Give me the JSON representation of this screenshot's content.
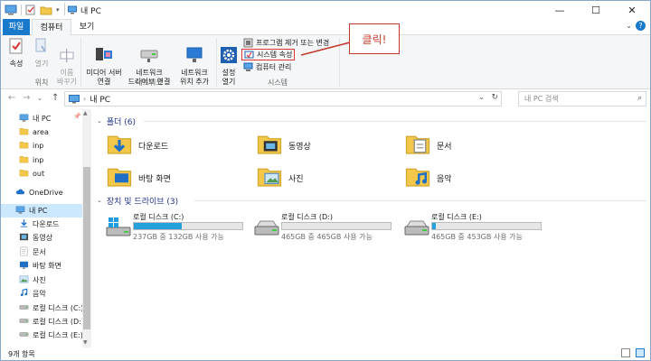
{
  "window": {
    "title": "내 PC",
    "minimize": "—",
    "maximize": "☐",
    "close": "✕"
  },
  "tabs": {
    "file": "파일",
    "computer": "컴퓨터",
    "view": "보기"
  },
  "ribbon": {
    "location": {
      "properties": "속성",
      "open": "열기",
      "rename": "이름\n바꾸기",
      "label": "위치"
    },
    "network": {
      "media_server": "미디어 서버\n연결",
      "map_drive": "네트워크\n드라이브 연결",
      "add_location": "네트워크\n위치 추가",
      "label": "네트워크"
    },
    "system": {
      "settings": "설정\n열기",
      "uninstall": "프로그램 제거 또는 변경",
      "system_props": "시스템 속성",
      "manage": "컴퓨터 관리",
      "label": "시스템"
    }
  },
  "callout": "클릭!",
  "address": {
    "path": "내 PC",
    "search_placeholder": "내 PC 검색"
  },
  "nav": {
    "items": [
      {
        "label": "내 PC",
        "icon": "pc-icon"
      },
      {
        "label": "area",
        "icon": "folder-icon"
      },
      {
        "label": "inp",
        "icon": "folder-icon"
      },
      {
        "label": "inp",
        "icon": "folder-icon"
      },
      {
        "label": "out",
        "icon": "folder-icon"
      },
      {
        "label": "OneDrive",
        "icon": "cloud-icon"
      },
      {
        "label": "내 PC",
        "icon": "pc-icon"
      },
      {
        "label": "다운로드",
        "icon": "download-icon"
      },
      {
        "label": "동영상",
        "icon": "video-icon"
      },
      {
        "label": "문서",
        "icon": "document-icon"
      },
      {
        "label": "바탕 화면",
        "icon": "desktop-icon"
      },
      {
        "label": "사진",
        "icon": "picture-icon"
      },
      {
        "label": "음악",
        "icon": "music-icon"
      },
      {
        "label": "로컬 디스크 (C:)",
        "icon": "drive-icon"
      },
      {
        "label": "로컬 디스크 (D:)",
        "icon": "drive-icon"
      },
      {
        "label": "로컬 디스크 (E:)",
        "icon": "drive-icon"
      }
    ]
  },
  "content": {
    "folders_header": "폴더 (6)",
    "folders": [
      {
        "label": "다운로드",
        "icon": "download-folder-icon"
      },
      {
        "label": "동영상",
        "icon": "video-folder-icon"
      },
      {
        "label": "문서",
        "icon": "document-folder-icon"
      },
      {
        "label": "바탕 화면",
        "icon": "desktop-folder-icon"
      },
      {
        "label": "사진",
        "icon": "picture-folder-icon"
      },
      {
        "label": "음악",
        "icon": "music-folder-icon"
      }
    ],
    "drives_header": "장치 및 드라이브 (3)",
    "drives": [
      {
        "name": "로컬 디스크 (C:)",
        "free": "237GB 중 132GB 사용 가능",
        "used_fraction": 0.44
      },
      {
        "name": "로컬 디스크 (D:)",
        "free": "465GB 중 465GB 사용 가능",
        "used_fraction": 0.0
      },
      {
        "name": "로컬 디스크 (E:)",
        "free": "465GB 중 453GB 사용 가능",
        "used_fraction": 0.03
      }
    ]
  },
  "status": {
    "count": "9개 항목"
  },
  "colors": {
    "accent": "#1979ca",
    "callout": "#c0392b",
    "selection": "#cce8ff",
    "drive_fill": "#26a0da"
  }
}
